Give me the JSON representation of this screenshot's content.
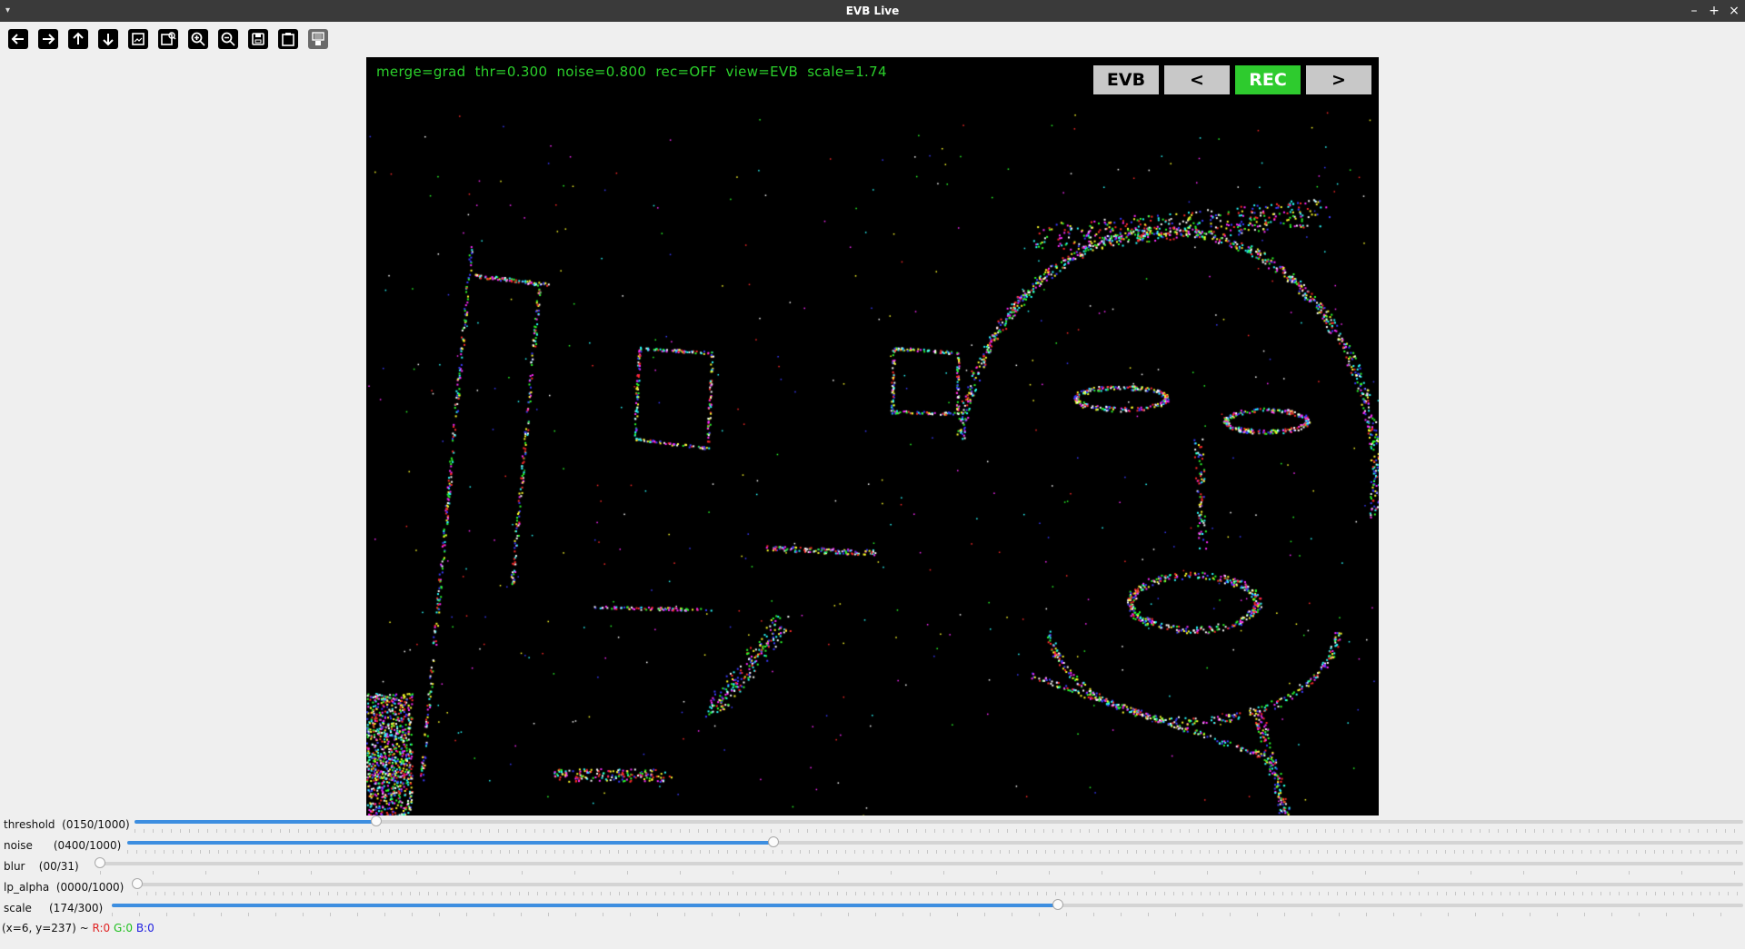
{
  "window": {
    "title": "EVB Live",
    "controls": {
      "minimize": "–",
      "maximize": "+",
      "close": "×"
    }
  },
  "toolbar": {
    "items": [
      {
        "name": "pan-left",
        "icon": "arrow-left-icon"
      },
      {
        "name": "pan-right",
        "icon": "arrow-right-icon"
      },
      {
        "name": "pan-up",
        "icon": "arrow-up-icon"
      },
      {
        "name": "pan-down",
        "icon": "arrow-down-icon"
      },
      {
        "name": "zoom-original",
        "icon": "zoom-original-icon"
      },
      {
        "name": "zoom-fit",
        "icon": "zoom-fit-icon"
      },
      {
        "name": "zoom-in",
        "icon": "zoom-in-icon"
      },
      {
        "name": "zoom-out",
        "icon": "zoom-out-icon"
      },
      {
        "name": "save-image",
        "icon": "save-icon"
      },
      {
        "name": "copy-clipboard",
        "icon": "clipboard-icon"
      },
      {
        "name": "properties",
        "icon": "properties-icon"
      }
    ]
  },
  "viewer": {
    "overlay_text": "merge=grad  thr=0.300  noise=0.800  rec=OFF  view=EVB  scale=1.74",
    "buttons": [
      {
        "label": "EVB",
        "bg": "#c8c8c8",
        "fg": "#000000"
      },
      {
        "label": "<",
        "bg": "#c8c8c8",
        "fg": "#000000"
      },
      {
        "label": "REC",
        "bg": "#2ecb2e",
        "fg": "#ffffff"
      },
      {
        "label": ">",
        "bg": "#c8c8c8",
        "fg": "#000000"
      }
    ]
  },
  "trackbars": [
    {
      "name": "threshold",
      "label": "threshold",
      "value_text": "(0150/1000)",
      "value": 150,
      "max": 1000
    },
    {
      "name": "noise",
      "label": "noise",
      "value_text": "(0400/1000)",
      "value": 400,
      "max": 1000
    },
    {
      "name": "blur",
      "label": "blur",
      "value_text": "(00/31)",
      "value": 0,
      "max": 31
    },
    {
      "name": "lp-alpha",
      "label": "lp_alpha",
      "value_text": "(0000/1000)",
      "value": 0,
      "max": 1000
    },
    {
      "name": "scale",
      "label": "scale",
      "value_text": "(174/300)",
      "value": 174,
      "max": 300
    }
  ],
  "status": {
    "coords": "(x=6, y=237) ~ ",
    "r": "R:0",
    "g": "G:0",
    "b": "B:0"
  },
  "colors": {
    "overlay_text": "#2bd02b",
    "slider_fill": "#3d8ee0"
  }
}
